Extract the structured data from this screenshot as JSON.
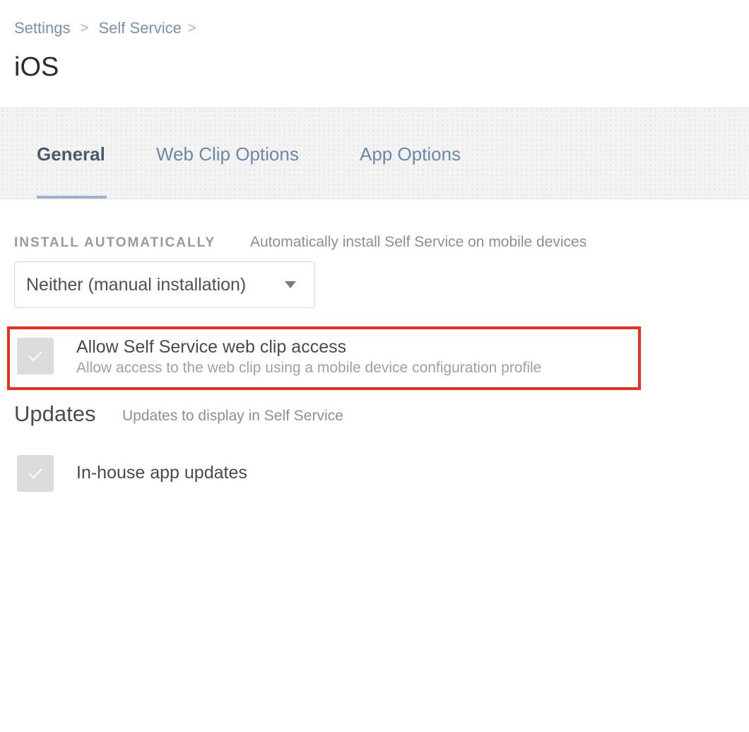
{
  "breadcrumb": {
    "items": [
      "Settings",
      "Self Service"
    ],
    "separator": ">"
  },
  "page": {
    "title": "iOS"
  },
  "tabs": [
    {
      "label": "General",
      "active": true
    },
    {
      "label": "Web Clip Options",
      "active": false
    },
    {
      "label": "App Options",
      "active": false
    }
  ],
  "install": {
    "label": "INSTALL AUTOMATICALLY",
    "description": "Automatically install Self Service on mobile devices",
    "selected": "Neither (manual installation)"
  },
  "web_clip": {
    "title": "Allow Self Service web clip access",
    "description": "Allow access to the web clip using a mobile device configuration profile",
    "checked": true
  },
  "updates": {
    "title": "Updates",
    "description": "Updates to display in Self Service",
    "items": [
      {
        "label": "In-house app updates",
        "checked": true
      }
    ]
  },
  "colors": {
    "accent": "#9fb2cf",
    "highlight": "#e8321f",
    "link": "#6d87a8"
  }
}
